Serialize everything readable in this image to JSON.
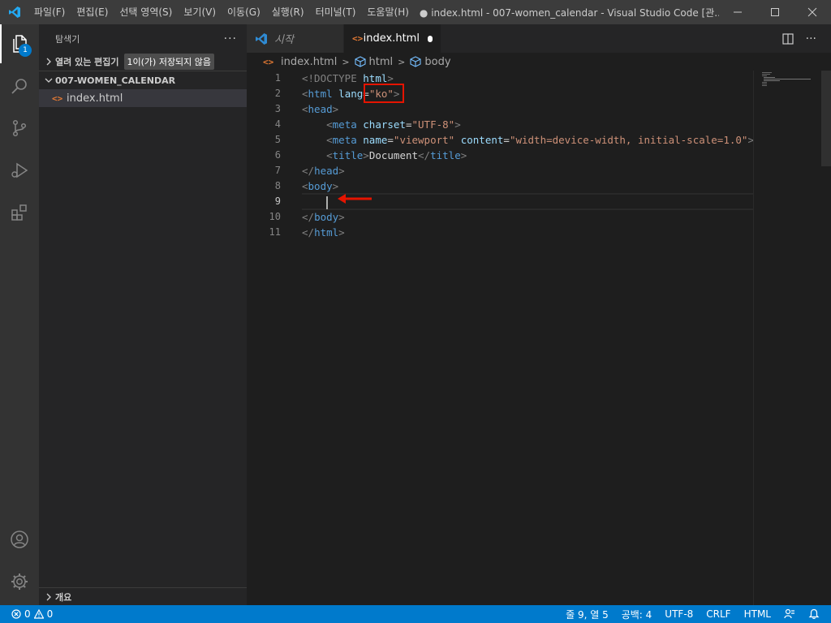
{
  "titlebar": {
    "menu": [
      "파일(F)",
      "편집(E)",
      "선택 영역(S)",
      "보기(V)",
      "이동(G)",
      "실행(R)",
      "터미널(T)",
      "도움말(H)"
    ],
    "window_title": "● index.html - 007-women_calendar - Visual Studio Code [관..."
  },
  "activitybar": {
    "explorer_badge": "1"
  },
  "sidebar": {
    "title": "탐색기",
    "more": "···",
    "open_editors_label": "열려 있는 편집기",
    "open_editors_badge": "1이(가) 저장되지 않음",
    "folder_label": "007-WOMEN_CALENDAR",
    "files": [
      {
        "name": "index.html"
      }
    ],
    "outline_label": "개요"
  },
  "tabs": [
    {
      "label": "시작",
      "active": false
    },
    {
      "label": "index.html",
      "active": true,
      "dirty": true
    }
  ],
  "breadcrumb": [
    "index.html",
    "html",
    "body"
  ],
  "editor": {
    "line_numbers": [
      "1",
      "2",
      "3",
      "4",
      "5",
      "6",
      "7",
      "8",
      "9",
      "10",
      "11"
    ],
    "cursor_line": 9
  },
  "statusbar": {
    "errors": "0",
    "warnings": "0",
    "position": "줄 9, 열 5",
    "spaces": "공백: 4",
    "encoding": "UTF-8",
    "eol": "CRLF",
    "language": "HTML"
  },
  "colors": {
    "accent": "#007acc",
    "highlight_box": "#e51400",
    "arrow": "#e51400"
  }
}
